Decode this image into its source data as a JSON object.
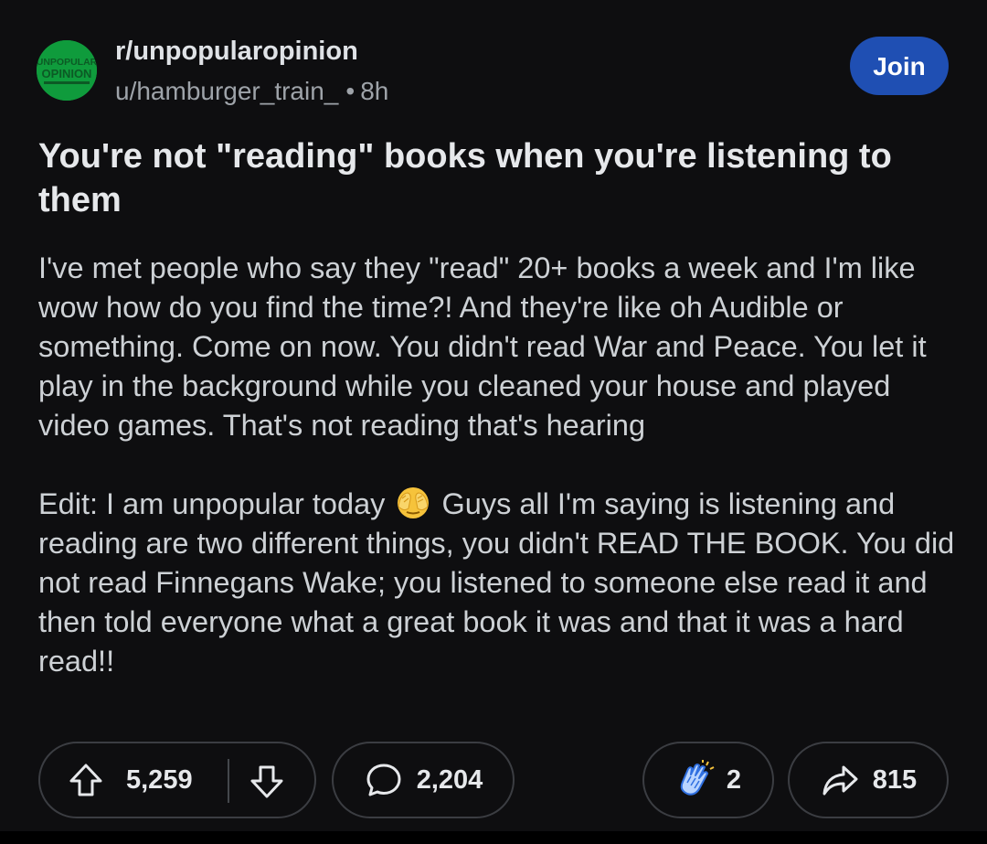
{
  "header": {
    "subreddit": "r/unpopularopinion",
    "username": "u/hamburger_train_",
    "separator": "•",
    "time": "8h",
    "join_label": "Join",
    "avatar_text_top": "UNPOPULAR",
    "avatar_text_bottom": "OPINION"
  },
  "post": {
    "title": "You're not \"reading\" books when you're listening to them",
    "body": "I've met people who say they \"read\" 20+ books a week and I'm like wow how do you find the time?! And they're like oh Audible or something. Come on now. You didn't read War and Peace. You let it play in the background while you cleaned your house and played video games. That's not reading that's hearing",
    "edit_before_emoji": "Edit: I am unpopular today",
    "edit_emoji": "face-with-hands-over-eyes-emoji",
    "edit_after_emoji": "Guys all I'm saying is listening and reading are two different things, you didn't READ THE BOOK. You did not read Finnegans Wake; you listened to someone else read it and then told everyone what a great book it was and that it was a hard read!!"
  },
  "actions": {
    "upvotes": "5,259",
    "comments": "2,204",
    "awards": "2",
    "shares": "815",
    "icons": {
      "upvote": "arrow-up-icon",
      "downvote": "arrow-down-icon",
      "comments": "speech-bubble-icon",
      "awards": "clapping-hands-award-icon",
      "share": "share-arrow-icon"
    }
  },
  "colors": {
    "background": "#0e0e10",
    "join_button": "#1f4fb3",
    "avatar_green": "#0f9b3c",
    "muted_text": "#9ea3a9",
    "pill_border": "#3b3d42"
  }
}
